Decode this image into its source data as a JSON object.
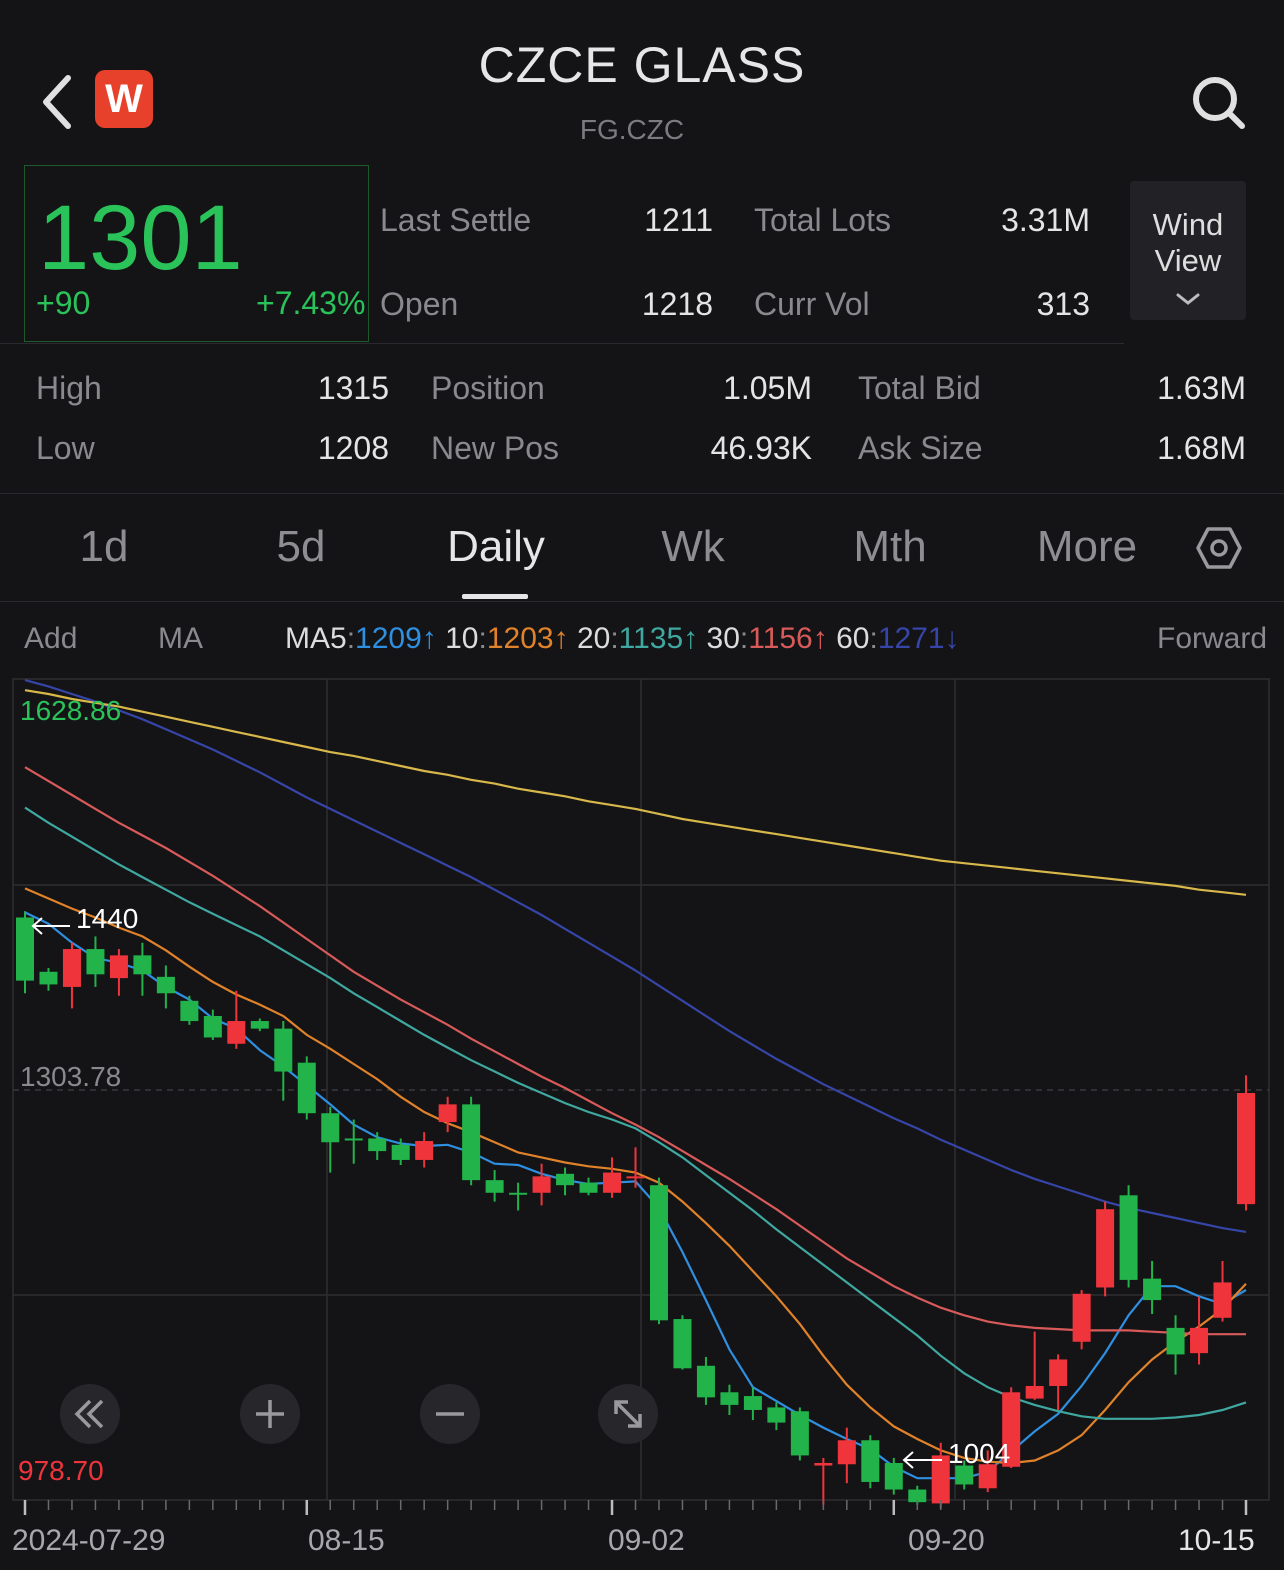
{
  "header": {
    "title": "CZCE GLASS",
    "code": "FG.CZC",
    "logo_letter": "W"
  },
  "quote": {
    "price": "1301",
    "change": "+90",
    "change_pct": "+7.43%",
    "last_settle_label": "Last Settle",
    "last_settle": "1211",
    "total_lots_label": "Total Lots",
    "total_lots": "3.31M",
    "open_label": "Open",
    "open": "1218",
    "curr_vol_label": "Curr Vol",
    "curr_vol": "313",
    "high_label": "High",
    "high": "1315",
    "low_label": "Low",
    "low": "1208",
    "position_label": "Position",
    "position": "1.05M",
    "new_pos_label": "New Pos",
    "new_pos": "46.93K",
    "total_bid_label": "Total Bid",
    "total_bid": "1.63M",
    "ask_size_label": "Ask Size",
    "ask_size": "1.68M"
  },
  "wind_view": {
    "line1": "Wind",
    "line2": "View"
  },
  "tabs": [
    {
      "label": "1d"
    },
    {
      "label": "5d"
    },
    {
      "label": "Daily"
    },
    {
      "label": "Wk"
    },
    {
      "label": "Mth"
    },
    {
      "label": "More"
    }
  ],
  "ma_bar": {
    "add": "Add",
    "ma": "MA",
    "ma5_label": "MA5",
    "ma5": "1209↑",
    "ma10_label": "10",
    "ma10": "1203↑",
    "ma20_label": "20",
    "ma20": "1135↑",
    "ma30_label": "30",
    "ma30": "1156↑",
    "ma60_label": "60",
    "ma60": "1271↓",
    "forward": "Forward"
  },
  "colors": {
    "up": "#f0343c",
    "down": "#22b34a",
    "ma5": "#2f8fe0",
    "ma10": "#e0822a",
    "ma20": "#3fa8a0",
    "ma30": "#d85a5a",
    "ma60": "#3645a8",
    "ma120": "#d8b84a"
  },
  "chart_data": {
    "type": "candlestick",
    "y_max_label": "1628.86",
    "y_mid_label": "1303.78",
    "y_min_label": "978.70",
    "ylim": [
      978.7,
      1628.86
    ],
    "high_marker": "1440",
    "low_marker": "1004",
    "x_tick_labels": [
      "2024-07-29",
      "08-15",
      "09-02",
      "09-20",
      "10-15"
    ],
    "candles": [
      [
        1440,
        1390,
        1445,
        1380
      ],
      [
        1397,
        1387,
        1400,
        1382
      ],
      [
        1385,
        1415,
        1420,
        1368
      ],
      [
        1415,
        1395,
        1425,
        1385
      ],
      [
        1392,
        1410,
        1415,
        1378
      ],
      [
        1410,
        1395,
        1420,
        1378
      ],
      [
        1393,
        1380,
        1402,
        1368
      ],
      [
        1374,
        1358,
        1378,
        1355
      ],
      [
        1362,
        1345,
        1367,
        1343
      ],
      [
        1340,
        1358,
        1382,
        1336
      ],
      [
        1358,
        1352,
        1360,
        1350
      ],
      [
        1352,
        1318,
        1358,
        1295
      ],
      [
        1325,
        1285,
        1330,
        1280
      ],
      [
        1285,
        1262,
        1290,
        1238
      ],
      [
        1265,
        1264,
        1280,
        1245
      ],
      [
        1265,
        1255,
        1270,
        1248
      ],
      [
        1260,
        1248,
        1265,
        1244
      ],
      [
        1248,
        1263,
        1270,
        1242
      ],
      [
        1278,
        1292,
        1298,
        1270
      ],
      [
        1292,
        1232,
        1298,
        1228
      ],
      [
        1232,
        1222,
        1240,
        1215
      ],
      [
        1222,
        1221,
        1230,
        1208
      ],
      [
        1222,
        1235,
        1245,
        1212
      ],
      [
        1237,
        1228,
        1242,
        1220
      ],
      [
        1230,
        1222,
        1234,
        1220
      ],
      [
        1222,
        1238,
        1250,
        1218
      ],
      [
        1235,
        1235,
        1258,
        1226
      ],
      [
        1228,
        1121,
        1234,
        1118
      ],
      [
        1122,
        1083,
        1125,
        1082
      ],
      [
        1085,
        1060,
        1092,
        1054
      ],
      [
        1064,
        1054,
        1070,
        1046
      ],
      [
        1061,
        1050,
        1068,
        1042
      ],
      [
        1052,
        1040,
        1056,
        1034
      ],
      [
        1049,
        1014,
        1052,
        1010
      ],
      [
        1006,
        1008,
        1012,
        975
      ],
      [
        1007,
        1026,
        1036,
        992
      ],
      [
        1026,
        993,
        1030,
        988
      ],
      [
        1008,
        987,
        1012,
        983
      ],
      [
        987,
        977,
        990,
        975
      ],
      [
        976,
        1014,
        1024,
        972
      ],
      [
        1006,
        991,
        1010,
        987
      ],
      [
        988,
        1007,
        1018,
        985
      ],
      [
        1005,
        1064,
        1068,
        1004
      ],
      [
        1059,
        1069,
        1112,
        1058
      ],
      [
        1069,
        1090,
        1094,
        1050
      ],
      [
        1104,
        1142,
        1145,
        1098
      ],
      [
        1147,
        1209,
        1215,
        1140
      ],
      [
        1220,
        1153,
        1228,
        1147
      ],
      [
        1154,
        1137,
        1168,
        1126
      ],
      [
        1115,
        1094,
        1125,
        1078
      ],
      [
        1095,
        1115,
        1140,
        1086
      ],
      [
        1123,
        1151,
        1168,
        1120
      ],
      [
        1213,
        1301,
        1315,
        1208
      ]
    ],
    "series": [
      {
        "name": "MA5",
        "values": [
          1444,
          1435,
          1420,
          1408,
          1404,
          1398,
          1385,
          1375,
          1360,
          1352,
          1335,
          1322,
          1307,
          1292,
          1276,
          1266,
          1261,
          1259,
          1260,
          1254,
          1245,
          1244,
          1237,
          1232,
          1229,
          1230,
          1231,
          1210,
          1175,
          1137,
          1098,
          1068,
          1057,
          1046,
          1036,
          1027,
          1019,
          1005,
          996,
          996,
          996,
          1001,
          1017,
          1033,
          1047,
          1069,
          1095,
          1125,
          1148,
          1148,
          1140,
          1134,
          1145
        ]
      },
      {
        "name": "10",
        "values": [
          1463,
          1455,
          1447,
          1440,
          1432,
          1425,
          1414,
          1401,
          1389,
          1379,
          1371,
          1362,
          1347,
          1336,
          1324,
          1312,
          1298,
          1286,
          1277,
          1270,
          1262,
          1254,
          1250,
          1246,
          1243,
          1241,
          1238,
          1230,
          1215,
          1198,
          1180,
          1160,
          1140,
          1118,
          1093,
          1070,
          1052,
          1037,
          1027,
          1018,
          1012,
          1009,
          1008,
          1010,
          1018,
          1030,
          1050,
          1072,
          1090,
          1104,
          1116,
          1130,
          1150
        ]
      },
      {
        "name": "20",
        "values": [
          1527,
          1515,
          1504,
          1493,
          1482,
          1472,
          1462,
          1452,
          1443,
          1434,
          1425,
          1414,
          1403,
          1392,
          1380,
          1369,
          1358,
          1347,
          1337,
          1327,
          1318,
          1309,
          1301,
          1293,
          1286,
          1280,
          1273,
          1262,
          1250,
          1236,
          1222,
          1208,
          1193,
          1179,
          1165,
          1151,
          1137,
          1123,
          1109,
          1093,
          1079,
          1068,
          1060,
          1054,
          1049,
          1045,
          1043,
          1043,
          1043,
          1044,
          1046,
          1050,
          1056
        ]
      },
      {
        "name": "30",
        "values": [
          1559,
          1548,
          1537,
          1526,
          1515,
          1505,
          1495,
          1484,
          1473,
          1461,
          1449,
          1436,
          1423,
          1410,
          1397,
          1386,
          1375,
          1365,
          1355,
          1344,
          1334,
          1324,
          1314,
          1305,
          1295,
          1285,
          1276,
          1266,
          1255,
          1244,
          1233,
          1221,
          1209,
          1196,
          1183,
          1170,
          1159,
          1148,
          1139,
          1131,
          1125,
          1120,
          1117,
          1115,
          1114,
          1113,
          1113,
          1113,
          1112,
          1111,
          1110,
          1110,
          1110
        ]
      },
      {
        "name": "60",
        "values": [
          1628,
          1623,
          1617,
          1611,
          1604,
          1597,
          1589,
          1581,
          1573,
          1564,
          1555,
          1545,
          1535,
          1526,
          1517,
          1508,
          1499,
          1490,
          1481,
          1472,
          1462,
          1452,
          1442,
          1431,
          1420,
          1409,
          1398,
          1386,
          1374,
          1362,
          1350,
          1339,
          1328,
          1318,
          1308,
          1299,
          1290,
          1281,
          1273,
          1264,
          1256,
          1248,
          1240,
          1233,
          1227,
          1221,
          1215,
          1210,
          1206,
          1202,
          1198,
          1194,
          1191
        ]
      },
      {
        "name": "120",
        "values": [
          1620,
          1617,
          1613,
          1610,
          1607,
          1603,
          1599,
          1595,
          1591,
          1587,
          1583,
          1579,
          1575,
          1571,
          1568,
          1564,
          1560,
          1556,
          1553,
          1549,
          1546,
          1542,
          1539,
          1536,
          1532,
          1529,
          1526,
          1522,
          1518,
          1515,
          1512,
          1509,
          1506,
          1503,
          1500,
          1497,
          1494,
          1491,
          1488,
          1485,
          1483,
          1481,
          1479,
          1477,
          1475,
          1473,
          1471,
          1469,
          1467,
          1465,
          1462,
          1460,
          1458
        ]
      }
    ]
  }
}
